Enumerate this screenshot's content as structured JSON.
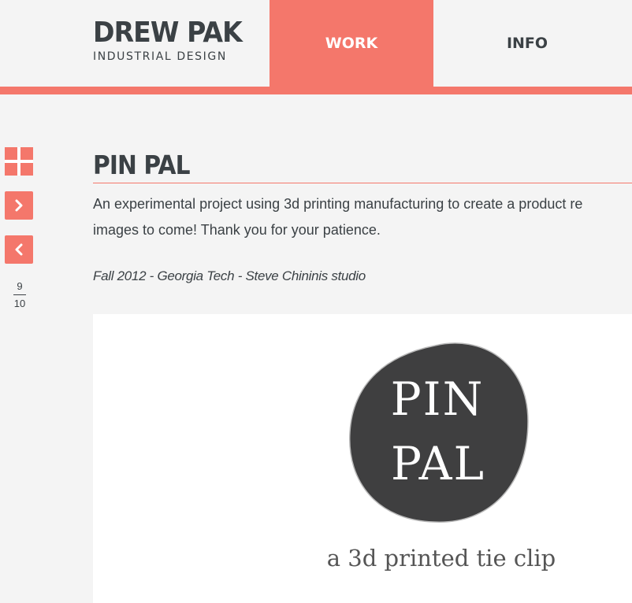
{
  "header": {
    "logo_name": "DREW PAK",
    "logo_sub": "INDUSTRIAL DESIGN",
    "nav": {
      "work": "WORK",
      "info": "INFO"
    }
  },
  "sidebar": {
    "grid_icon": "grid-icon",
    "next_icon": "chevron-right-icon",
    "prev_icon": "chevron-left-icon",
    "page_current": "9",
    "page_total": "10"
  },
  "project": {
    "title": "PIN PAL",
    "description_line1": "An experimental project using 3d printing manufacturing to create a product re",
    "description_line2": "images to come! Thank you for your patience.",
    "meta": "Fall 2012 - Georgia Tech - Steve Chininis studio",
    "image": {
      "logo_line1": "PIN",
      "logo_line2": "PAL",
      "tagline": "a 3d printed tie clip"
    }
  },
  "colors": {
    "accent": "#f4776b",
    "text": "#3b4145",
    "background": "#f4f4f4",
    "logo_circle": "#3f3f40"
  }
}
